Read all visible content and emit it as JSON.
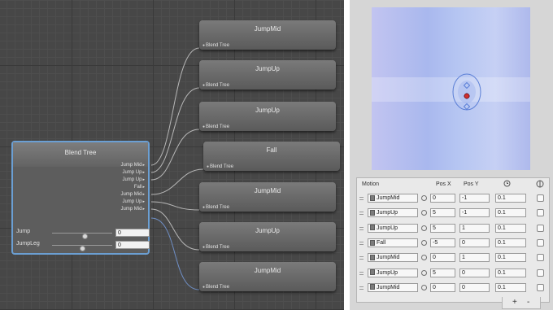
{
  "graph": {
    "children": [
      {
        "title": "JumpMid",
        "port": "Blend Tree"
      },
      {
        "title": "JumpUp",
        "port": "Blend Tree"
      },
      {
        "title": "JumpUp",
        "port": "Blend Tree"
      },
      {
        "title": "Fall",
        "port": "Blend Tree"
      },
      {
        "title": "JumpMid",
        "port": "Blend Tree"
      },
      {
        "title": "JumpUp",
        "port": "Blend Tree"
      },
      {
        "title": "JumpMid",
        "port": "Blend Tree"
      }
    ],
    "blend_node": {
      "title": "Blend Tree",
      "ports": [
        "Jump Mid",
        "Jump Up",
        "Jump Up",
        "Fall",
        "Jump Mid",
        "Jump Up",
        "Jump Mid"
      ],
      "params": [
        {
          "name": "Jump",
          "value": "0",
          "level": 0.55
        },
        {
          "name": "JumpLeg",
          "value": "0",
          "level": 0.5
        }
      ]
    }
  },
  "inspector": {
    "table": {
      "headers": {
        "motion": "Motion",
        "posx": "Pos X",
        "posy": "Pos Y",
        "speed_icon": "clock-icon",
        "mirror_icon": "mirror-icon"
      },
      "rows": [
        {
          "motion": "JumpMid",
          "posx": "0",
          "posy": "-1",
          "speed": "0.1"
        },
        {
          "motion": "JumpUp",
          "posx": "5",
          "posy": "-1",
          "speed": "0.1"
        },
        {
          "motion": "JumpUp",
          "posx": "5",
          "posy": "1",
          "speed": "0.1"
        },
        {
          "motion": "Fall",
          "posx": "-5",
          "posy": "0",
          "speed": "0.1"
        },
        {
          "motion": "JumpMid",
          "posx": "0",
          "posy": "1",
          "speed": "0.1"
        },
        {
          "motion": "JumpUp",
          "posx": "5",
          "posy": "0",
          "speed": "0.1"
        },
        {
          "motion": "JumpMid",
          "posx": "0",
          "posy": "0",
          "speed": "0.1"
        }
      ],
      "add_label": "+",
      "remove_label": "-"
    }
  },
  "colors": {
    "node_selected_border": "#6b9fd3",
    "blend_point": "#5b7fd6",
    "current_point": "#d03030"
  }
}
